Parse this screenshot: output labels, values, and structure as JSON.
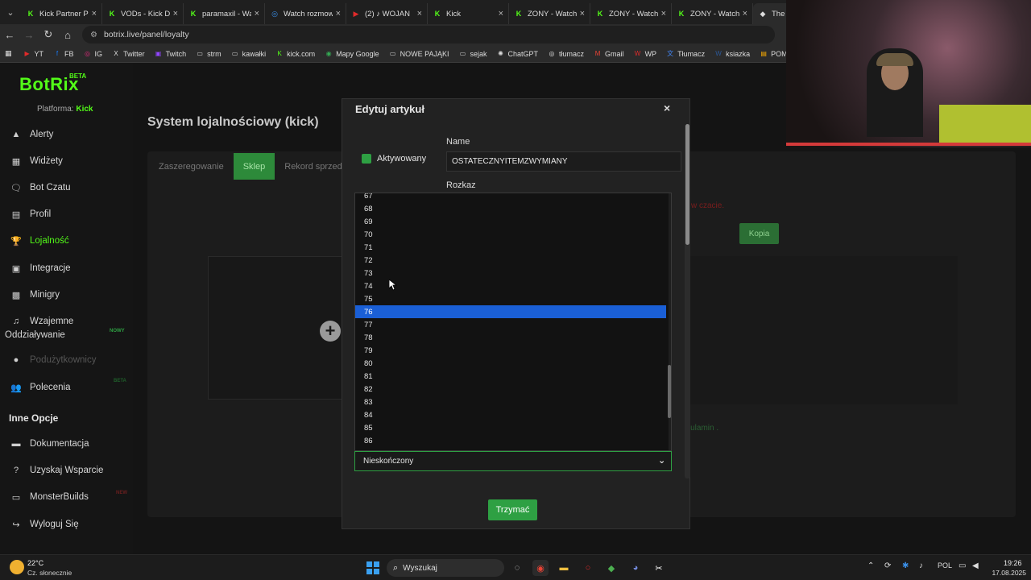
{
  "browser": {
    "tabs": [
      {
        "label": "Kick Partner Pr",
        "icon_color": "#53fc18",
        "icon": "K"
      },
      {
        "label": "VODs - Kick Da",
        "icon_color": "#53fc18",
        "icon": "K"
      },
      {
        "label": "paramaxil - Wa",
        "icon_color": "#53fc18",
        "icon": "K"
      },
      {
        "label": "Watch rozmow",
        "icon_color": "#3a8ee6",
        "icon": "◎"
      },
      {
        "label": "(2) ♪ WOJAN",
        "icon_color": "#e02a2a",
        "icon": "▶"
      },
      {
        "label": "Kick",
        "icon_color": "#53fc18",
        "icon": "K"
      },
      {
        "label": "ZONY - Watch",
        "icon_color": "#53fc18",
        "icon": "K"
      },
      {
        "label": "ZONY - Watch",
        "icon_color": "#53fc18",
        "icon": "K"
      },
      {
        "label": "ZONY - Watch",
        "icon_color": "#53fc18",
        "icon": "K"
      },
      {
        "label": "The be",
        "icon_color": "#dddddd",
        "icon": "◆"
      }
    ],
    "url": "botrix.live/panel/loyalty",
    "bookmarks": [
      {
        "label": "YT",
        "color": "#e02a2a",
        "icon": "▶"
      },
      {
        "label": "FB",
        "color": "#1877f2",
        "icon": "f"
      },
      {
        "label": "IG",
        "color": "#d62976",
        "icon": "◎"
      },
      {
        "label": "Twitter",
        "color": "#dddddd",
        "icon": "X"
      },
      {
        "label": "Twitch",
        "color": "#9146ff",
        "icon": "▣"
      },
      {
        "label": "strm",
        "color": "#cccccc",
        "icon": "▭"
      },
      {
        "label": "kawałki",
        "color": "#cccccc",
        "icon": "▭"
      },
      {
        "label": "kick.com",
        "color": "#53fc18",
        "icon": "K"
      },
      {
        "label": "Mapy Google",
        "color": "#34a853",
        "icon": "◉"
      },
      {
        "label": "NOWE PAJĄKI",
        "color": "#cccccc",
        "icon": "▭"
      },
      {
        "label": "sejak",
        "color": "#cccccc",
        "icon": "▭"
      },
      {
        "label": "ChatGPT",
        "color": "#dddddd",
        "icon": "✺"
      },
      {
        "label": "tłumacz",
        "color": "#dddddd",
        "icon": "◎"
      },
      {
        "label": "Gmail",
        "color": "#ea4335",
        "icon": "M"
      },
      {
        "label": "WP",
        "color": "#e02a2a",
        "icon": "W"
      },
      {
        "label": "Tłumacz",
        "color": "#4285f4",
        "icon": "文"
      },
      {
        "label": "ksiazka",
        "color": "#2b5797",
        "icon": "W"
      },
      {
        "label": "POMYSŁY NA STRE...",
        "color": "#f9ab00",
        "icon": "▤"
      }
    ]
  },
  "sidebar": {
    "logo": "BotRix",
    "logo_badge": "BETA",
    "platform_label": "Platforma:",
    "platform_value": "Kick",
    "items": [
      {
        "label": "Alerty",
        "icon": "▲"
      },
      {
        "label": "Widżety",
        "icon": "▦"
      },
      {
        "label": "Bot Czatu",
        "icon": "🗨"
      },
      {
        "label": "Profil",
        "icon": "▤"
      },
      {
        "label": "Lojalność",
        "icon": "🏆"
      },
      {
        "label": "Integracje",
        "icon": "▣"
      },
      {
        "label": "Minigry",
        "icon": "▩"
      },
      {
        "label": "Wzajemne",
        "icon": "♫"
      },
      {
        "label": "Oddziaływanie",
        "icon": ""
      },
      {
        "label": "Podużytkownicy",
        "icon": "●"
      },
      {
        "label": "Polecenia",
        "icon": "👥"
      }
    ],
    "badge_new": "NOWY",
    "badge_beta": "BETA",
    "section_title": "Inne Opcje",
    "other_items": [
      {
        "label": "Dokumentacja",
        "icon": "▬"
      },
      {
        "label": "Uzyskaj Wsparcie",
        "icon": "?"
      },
      {
        "label": "MonsterBuilds",
        "icon": "▭"
      },
      {
        "label": "Wyloguj Się",
        "icon": "↪"
      }
    ],
    "badge_monster": "NEW"
  },
  "main": {
    "title": "System lojalnościowy (kick)",
    "tabs": [
      {
        "label": "Zaszeregowanie"
      },
      {
        "label": "Sklep"
      },
      {
        "label": "Rekord sprzedaż"
      }
    ],
    "red_hint": "w czacie.",
    "kopia_label": "Kopia",
    "regulamin": "egulamin ."
  },
  "modal": {
    "title": "Edytuj artykuł",
    "close": "×",
    "activated_label": "Aktywowany",
    "name_label": "Name",
    "name_value": "OSTATECZNYITEMZWYMIANY",
    "command_label": "Rozkaz",
    "options": [
      "67",
      "68",
      "69",
      "70",
      "71",
      "72",
      "73",
      "74",
      "75",
      "76",
      "77",
      "78",
      "79",
      "80",
      "81",
      "82",
      "83",
      "84",
      "85",
      "86"
    ],
    "selected_option": "76",
    "select_value": "Nieskończony",
    "save_label": "Trzymać"
  },
  "taskbar": {
    "temperature": "22°C",
    "weather": "Cz. słonecznie",
    "search_placeholder": "Wyszukaj",
    "language": "POL",
    "time": "19:26",
    "date": "17.08.2025"
  }
}
